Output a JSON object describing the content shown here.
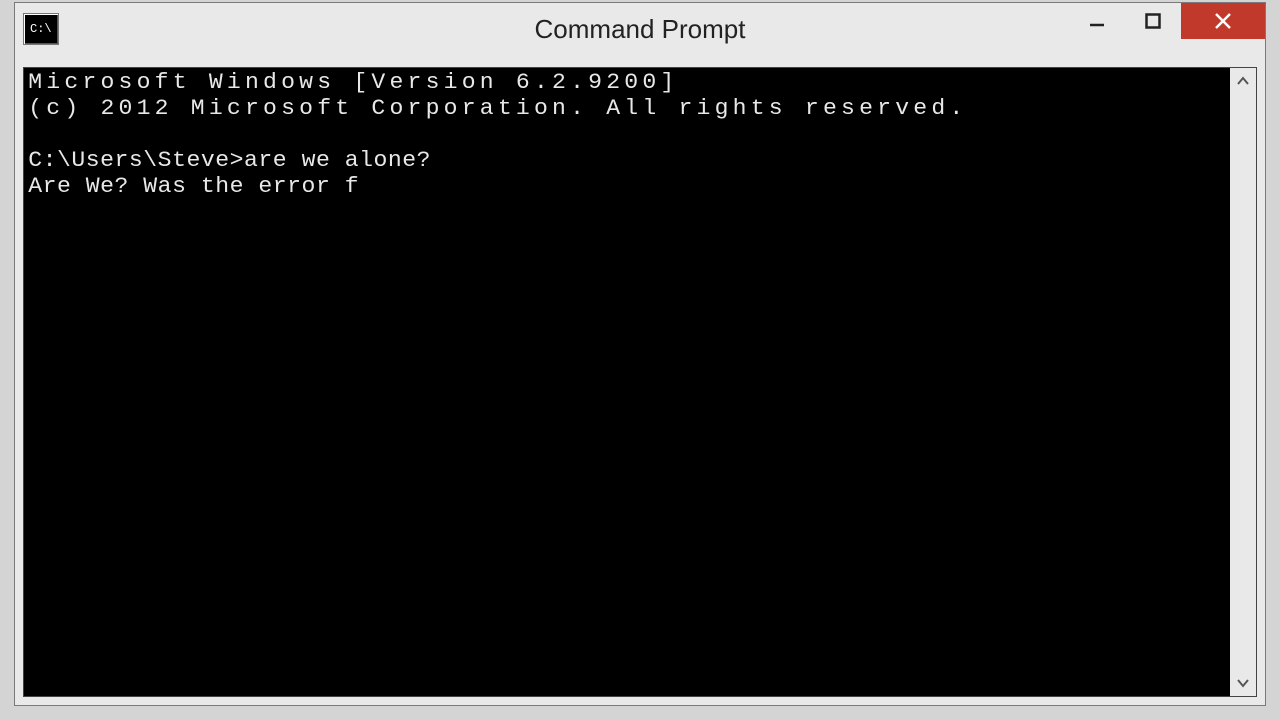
{
  "window": {
    "title": "Command Prompt"
  },
  "console": {
    "line1": "Microsoft Windows [Version 6.2.9200]",
    "line2": "(c) 2012 Microsoft Corporation. All rights reserved.",
    "blank": "",
    "prompt": "C:\\Users\\Steve>",
    "command": "are we alone?",
    "output": "Are We? Was the error f"
  }
}
